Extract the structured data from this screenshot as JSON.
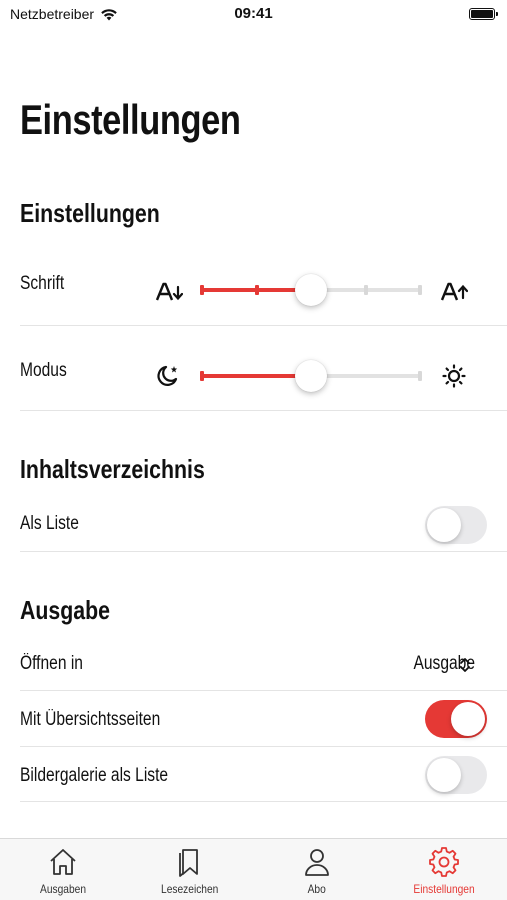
{
  "status_bar": {
    "carrier": "Netzbetreiber",
    "time": "09:41"
  },
  "page": {
    "title": "Einstellungen"
  },
  "sections": {
    "einstellungen": {
      "title": "Einstellungen",
      "font_row": {
        "label": "Schrift",
        "icon_left": "font-size-decrease-icon",
        "icon_right": "font-size-increase-icon",
        "value": 0.5,
        "steps": 5
      },
      "mode_row": {
        "label": "Modus",
        "icon_left": "moon-icon",
        "icon_right": "sun-icon",
        "value": 0.5
      }
    },
    "inhaltsverzeichnis": {
      "title": "Inhaltsverzeichnis",
      "list_row": {
        "label": "Als Liste",
        "on": false
      }
    },
    "ausgabe": {
      "title": "Ausgabe",
      "open_row": {
        "label": "Öffnen in",
        "value": "Ausgabe"
      },
      "overview_row": {
        "label": "Mit Übersichtsseiten",
        "on": true
      },
      "gallery_row": {
        "label": "Bildergalerie als Liste",
        "on": false
      }
    }
  },
  "tab_bar": {
    "active_color": "#e53935",
    "tabs": [
      {
        "label": "Ausgaben",
        "icon": "home-icon"
      },
      {
        "label": "Lesezeichen",
        "icon": "bookmark-icon"
      },
      {
        "label": "Abo",
        "icon": "person-icon"
      },
      {
        "label": "Einstellungen",
        "icon": "gear-icon",
        "active": true
      }
    ]
  }
}
